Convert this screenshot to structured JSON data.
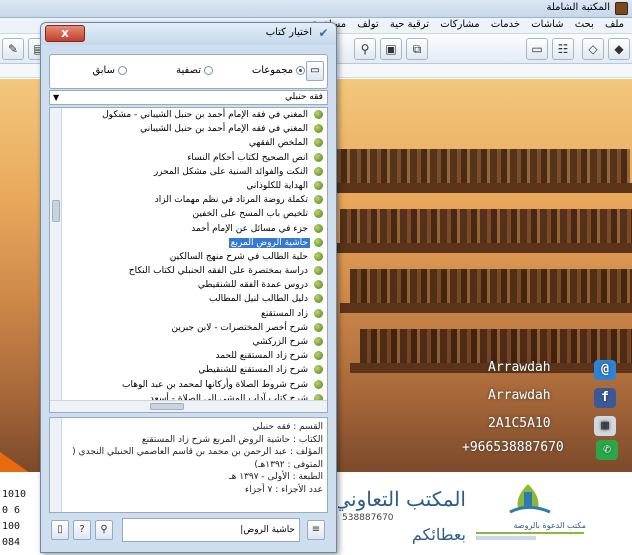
{
  "main_window": {
    "title": "المكتبة الشاملة",
    "menu": [
      "ملف",
      "بحث",
      "شاشات",
      "خدمات",
      "مشاركات",
      "ترقية حية",
      "تولف",
      "مساعدة"
    ],
    "toolbar_icons": [
      "pencil-icon",
      "stamp-icon",
      "eraser-icon",
      "search-binoculars-icon",
      "tree-icon",
      "book-icon",
      "copy-icon"
    ]
  },
  "background_contacts": [
    {
      "text": "Arrawdah",
      "icon": "at-icon",
      "color": "#2d84d6"
    },
    {
      "text": "Arrawdah",
      "icon": "facebook-icon",
      "color": "#3b5998"
    },
    {
      "text": "2A1C5A10",
      "icon": "bbm-icon",
      "color": "#d0d8e0"
    },
    {
      "text": "+966538887670",
      "icon": "whatsapp-icon",
      "color": "#2aa747"
    }
  ],
  "left_digits": [
    "1010",
    "0 6",
    "100",
    "084"
  ],
  "dialog": {
    "title": "اختيار كتاب",
    "close_glyph": "x",
    "radios": [
      {
        "label": "مجموعات",
        "checked": true
      },
      {
        "label": "تصفية",
        "checked": false
      },
      {
        "label": "سابق",
        "checked": false
      }
    ],
    "category": "فقه حنبلي",
    "books": [
      "المغني في فقه الإمام أحمد بن حنبل الشيباني - مشكول",
      "المغني في فقه الإمام أحمد بن حنبل الشيباني",
      "الملخص الفقهي",
      "انص الصحيح لكتاب أحكام النساء",
      "النكت والفوائد السنية على مشكل المحرر",
      "الهداية للكلوذاني",
      "تكملة روضة المرتاد في نظم مهمات الزاد",
      "تلخيص باب المسح على الخفين",
      "جزء في مسائل عن الإمام أحمد",
      "حاشية الروض المربع",
      "حلية الطالب في شرح منهج السالكين",
      "دراسة بمختصرة على الفقه الحنبلي لكتاب النكاح",
      "دروس عمدة الفقه للشنقيطي",
      "دليل الطالب لنيل المطالب",
      "زاد المستقنع",
      "شرح أخصر المختصرات - لابن جبرين",
      "شرح الزركشي",
      "شرح زاد المستقنع للحمد",
      "شرح زاد المستقنع للشنقيطي",
      "شرح شروط الصلاة وأركانها لمحمد بن عبد الوهاب",
      "شرح كتاب آداب المشي إلى الصلاة - أسعد"
    ],
    "selected_book": "حاشية الروض المربع",
    "info": {
      "section": "القسم : فقه حنبلي",
      "book": "الكتاب : حاشية الروض المربع شرح زاد المستقنع",
      "author": "المؤلف : عبد الرحمن بن محمد بن قاسم العاصمي الحنبلي النجدي (",
      "died": "المتوفى : ١٣٩٢هـ)",
      "edition": "الطبعة : الأولى - ١٣٩٧ هـ",
      "parts": "عدد الأجزاء : ٧ أجزاء"
    },
    "search_value": "حاشية الروض|"
  },
  "logos": {
    "big_title": "المكتب التعاوني",
    "big_sub": "بعطائكم",
    "big_phone": "538887670",
    "small_name": "مكتب الدعوة بالروضة"
  }
}
